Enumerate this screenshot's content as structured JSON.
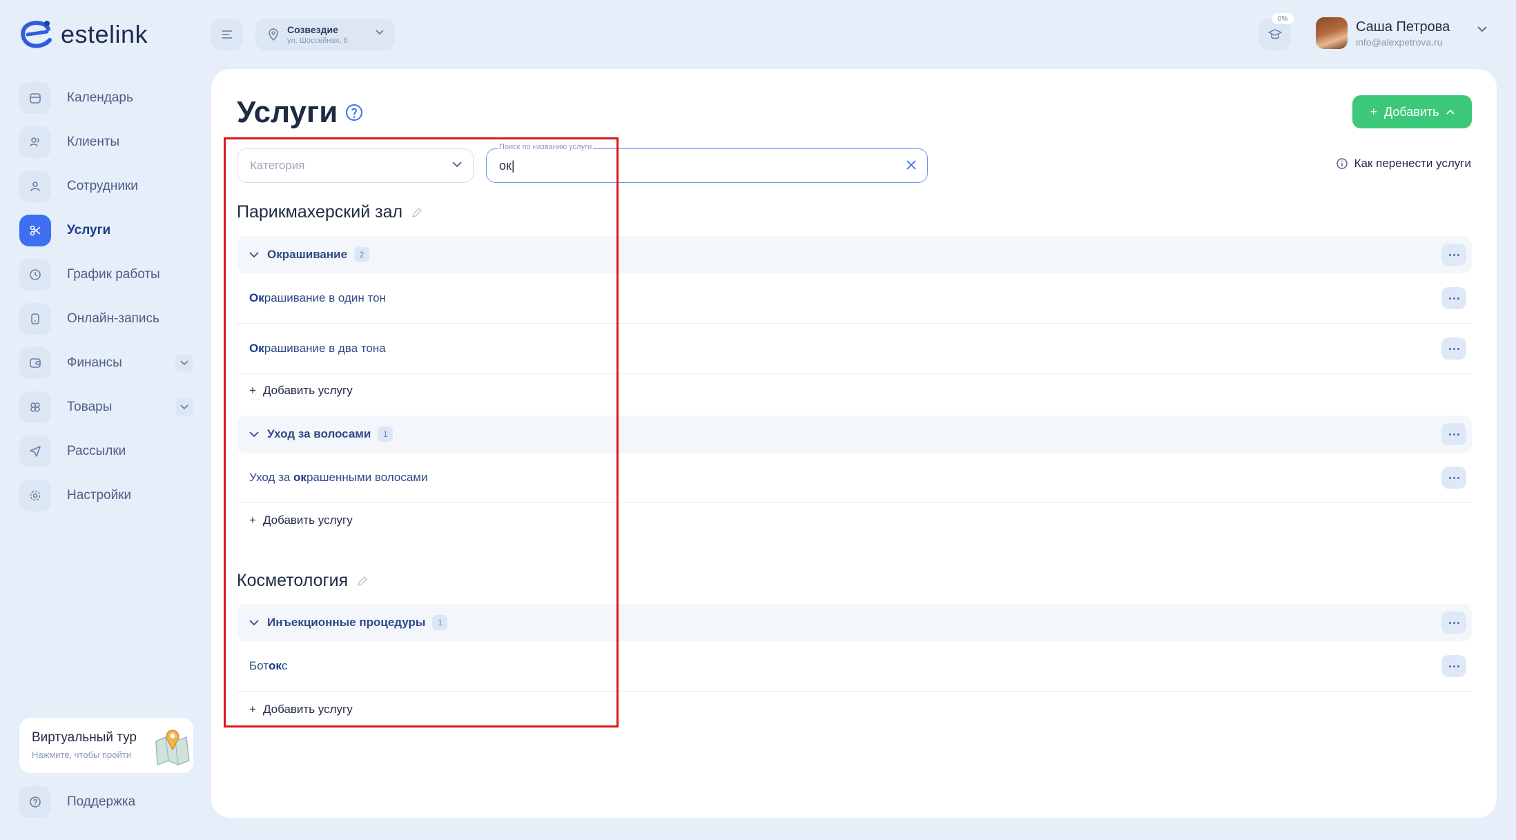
{
  "brand": {
    "name": "estelink"
  },
  "nav": {
    "items": [
      {
        "label": "Календарь",
        "icon": "calendar-icon",
        "active": false,
        "has_submenu": false
      },
      {
        "label": "Клиенты",
        "icon": "clients-icon",
        "active": false,
        "has_submenu": false
      },
      {
        "label": "Сотрудники",
        "icon": "employee-icon",
        "active": false,
        "has_submenu": false
      },
      {
        "label": "Услуги",
        "icon": "scissors-icon",
        "active": true,
        "has_submenu": false
      },
      {
        "label": "График работы",
        "icon": "clock-icon",
        "active": false,
        "has_submenu": false
      },
      {
        "label": "Онлайн-запись",
        "icon": "phone-icon",
        "active": false,
        "has_submenu": false
      },
      {
        "label": "Финансы",
        "icon": "wallet-icon",
        "active": false,
        "has_submenu": true
      },
      {
        "label": "Товары",
        "icon": "products-icon",
        "active": false,
        "has_submenu": true
      },
      {
        "label": "Рассылки",
        "icon": "send-icon",
        "active": false,
        "has_submenu": false
      },
      {
        "label": "Настройки",
        "icon": "gear-icon",
        "active": false,
        "has_submenu": false
      }
    ],
    "support_label": "Поддержка"
  },
  "tour": {
    "title": "Виртуальный тур",
    "subtitle": "Нажмите, чтобы пройти"
  },
  "topbar": {
    "branch_name": "Созвездие",
    "branch_address": "ул. Шоссейная, 8",
    "progress_label": "0%",
    "user_name": "Саша Петрова",
    "user_email": "info@alexpetrova.ru"
  },
  "page": {
    "title": "Услуги",
    "add_button_label": "Добавить",
    "category_placeholder": "Категория",
    "search_label": "Поиск по названию услуги",
    "search_value": "ок",
    "how_to_link": "Как перенести услуги",
    "add_service_label": "Добавить услугу"
  },
  "sections": [
    {
      "title": "Парикмахерский зал",
      "groups": [
        {
          "name": "Окрашивание",
          "count": "2",
          "services": [
            {
              "match": "Ок",
              "rest": "рашивание в один тон",
              "before": ""
            },
            {
              "match": "Ок",
              "rest": "рашивание в два тона",
              "before": ""
            }
          ]
        },
        {
          "name": "Уход за волосами",
          "count": "1",
          "services": [
            {
              "before": "Уход за ",
              "match": "ок",
              "rest": "рашенными волосами"
            }
          ]
        }
      ]
    },
    {
      "title": "Косметология",
      "groups": [
        {
          "name": "Инъекционные процедуры",
          "count": "1",
          "services": [
            {
              "before": "Бот",
              "match": "ок",
              "rest": "с"
            }
          ]
        }
      ]
    }
  ],
  "colors": {
    "accent": "#3d6ff0",
    "add_button": "#3cc87a",
    "highlight": "#e0141c",
    "background": "#e6eef9"
  }
}
